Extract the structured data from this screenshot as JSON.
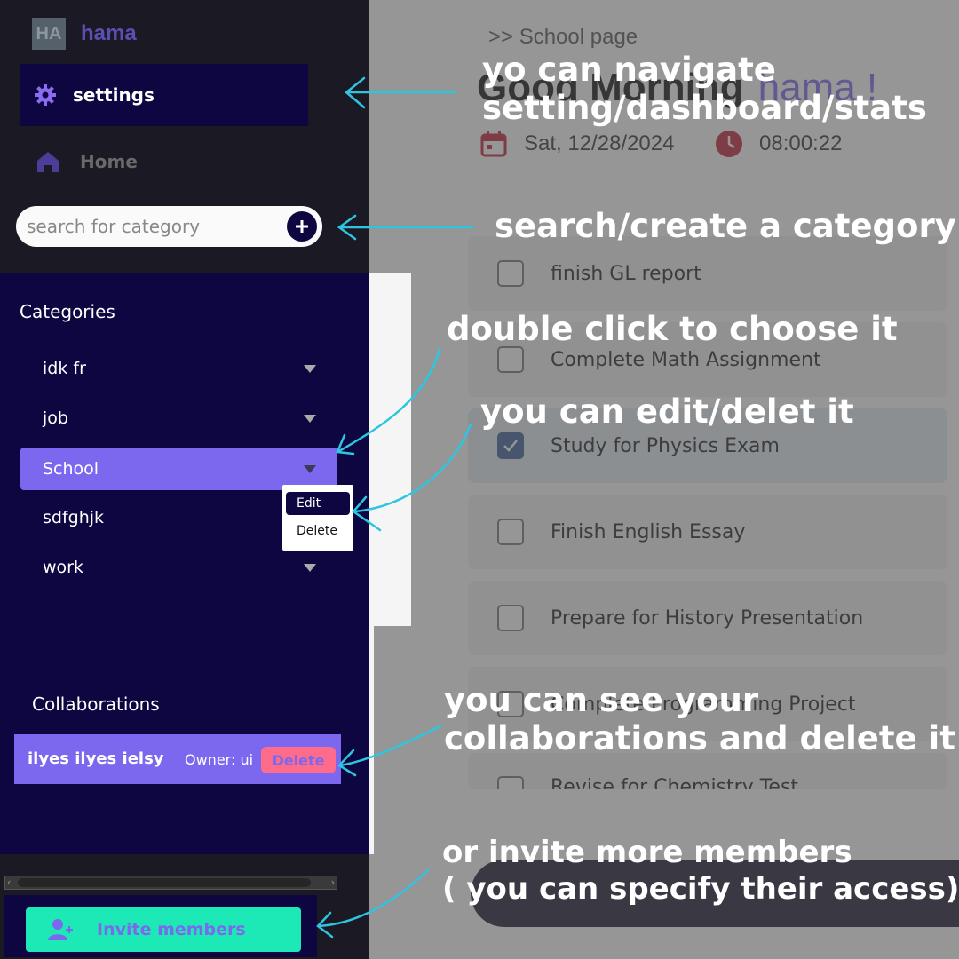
{
  "brand": {
    "logo_text": "HA",
    "name": "hama"
  },
  "nav": {
    "settings_label": "settings",
    "home_label": "Home"
  },
  "search": {
    "placeholder": "search for category"
  },
  "categories": {
    "title": "Categories",
    "items": [
      {
        "label": "idk fr"
      },
      {
        "label": "job"
      },
      {
        "label": "School"
      },
      {
        "label": "sdfghjk"
      },
      {
        "label": "work"
      }
    ],
    "selected": "School",
    "context_menu": {
      "edit_label": "Edit",
      "delete_label": "Delete"
    }
  },
  "collaborations": {
    "title": "Collaborations",
    "row": {
      "name": "ilyes ilyes ielsy",
      "owner": "Owner: ui",
      "delete_label": "Delete"
    }
  },
  "invite": {
    "label": "Invite members"
  },
  "main": {
    "breadcrumb": ">> School page",
    "greeting": "Good Morning",
    "username": "hama !",
    "date": "Sat, 12/28/2024",
    "time": "08:00:22",
    "tasks": [
      {
        "title": "finish GL report",
        "checked": false
      },
      {
        "title": "Complete Math Assignment",
        "checked": false
      },
      {
        "title": "Study for Physics Exam",
        "checked": true
      },
      {
        "title": "Finish English Essay",
        "checked": false
      },
      {
        "title": "Prepare for History Presentation",
        "checked": false
      },
      {
        "title": "Complete Programming Project",
        "checked": false
      },
      {
        "title": "Revise for Chemistry Test",
        "checked": false
      }
    ]
  },
  "annotations": {
    "nav": [
      "yo can navigate",
      "setting/dashboard/stats"
    ],
    "search": "search/create a category",
    "choose": "double click to choose it",
    "edit": "you can edit/delet it",
    "collab": [
      "you can see your",
      "collaborations and delete it"
    ],
    "invite": [
      "or invite more members",
      "( you can specify their access)"
    ]
  },
  "colors": {
    "accent": "#7b68ee",
    "sidebar_dark": "#0e0640",
    "invite": "#1de9b6",
    "danger": "#ff6b8a",
    "arrow": "#2ec5e0"
  }
}
